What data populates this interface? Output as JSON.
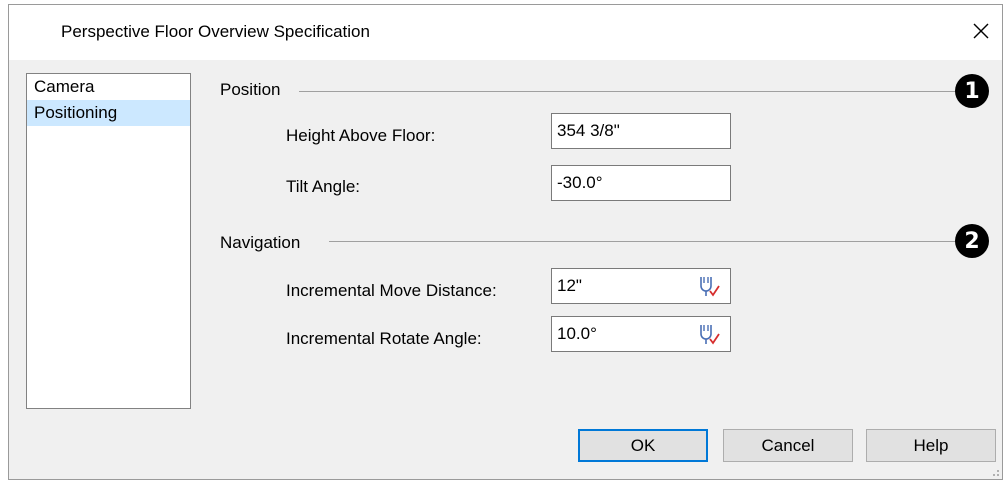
{
  "window": {
    "title": "Perspective Floor Overview Specification"
  },
  "sidebar": {
    "items": [
      {
        "label": "Camera",
        "selected": false
      },
      {
        "label": "Positioning",
        "selected": true
      }
    ]
  },
  "position_group": {
    "label": "Position",
    "callout": "1",
    "height_above_floor": {
      "label": "Height Above Floor:",
      "value": "354 3/8\""
    },
    "tilt_angle": {
      "label": "Tilt Angle:",
      "value": "-30.0°"
    }
  },
  "navigation_group": {
    "label": "Navigation",
    "callout": "2",
    "move_distance": {
      "label": "Incremental Move Distance:",
      "value": "12\""
    },
    "rotate_angle": {
      "label": "Incremental Rotate Angle:",
      "value": "10.0°"
    }
  },
  "buttons": {
    "ok": "OK",
    "cancel": "Cancel",
    "help": "Help"
  },
  "colors": {
    "selection": "#cce8ff",
    "default_button_border": "#0078d7",
    "check_mark": "#d62d2d"
  },
  "icons": {
    "close": "close-icon",
    "dimension": "dimension-edit-icon"
  }
}
